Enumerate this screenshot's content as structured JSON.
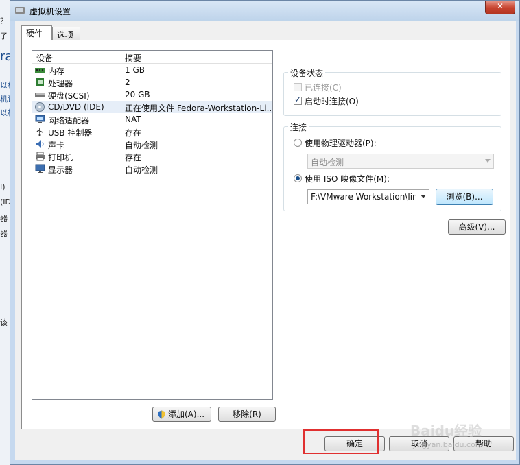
{
  "background_window": {
    "fragments": [
      "？",
      "了",
      "ra",
      "以材",
      "机设",
      "以材",
      "I)",
      "(ID",
      "器",
      "器",
      "该"
    ]
  },
  "dialog": {
    "title": "虚拟机设置",
    "tabs": [
      {
        "label": "硬件",
        "active": true
      },
      {
        "label": "选项",
        "active": false
      }
    ]
  },
  "device_list": {
    "columns": {
      "device": "设备",
      "summary": "摘要"
    },
    "rows": [
      {
        "name": "内存",
        "summary": "1 GB",
        "icon": "memory-icon"
      },
      {
        "name": "处理器",
        "summary": "2",
        "icon": "cpu-icon"
      },
      {
        "name": "硬盘(SCSI)",
        "summary": "20 GB",
        "icon": "harddisk-icon"
      },
      {
        "name": "CD/DVD (IDE)",
        "summary": "正在使用文件 Fedora-Workstation-Li...",
        "icon": "cdrom-icon",
        "selected": true
      },
      {
        "name": "网络适配器",
        "summary": "NAT",
        "icon": "network-icon"
      },
      {
        "name": "USB 控制器",
        "summary": "存在",
        "icon": "usb-icon"
      },
      {
        "name": "声卡",
        "summary": "自动检测",
        "icon": "sound-icon"
      },
      {
        "name": "打印机",
        "summary": "存在",
        "icon": "printer-icon"
      },
      {
        "name": "显示器",
        "summary": "自动检测",
        "icon": "monitor-icon"
      }
    ],
    "add_button": "添加(A)...",
    "remove_button": "移除(R)"
  },
  "device_status": {
    "title": "设备状态",
    "connected": {
      "label": "已连接(C)",
      "checked": false,
      "disabled": true
    },
    "connect_at_power_on": {
      "label": "启动时连接(O)",
      "checked": true
    }
  },
  "connection": {
    "title": "连接",
    "use_physical": {
      "label": "使用物理驱动器(P):",
      "selected": false
    },
    "physical_drive_value": "自动检测",
    "use_iso": {
      "label": "使用 ISO 映像文件(M):",
      "selected": true
    },
    "iso_path": "F:\\VMware Workstation\\linu",
    "browse_button": "浏览(B)..."
  },
  "advanced_button": "高级(V)...",
  "footer": {
    "ok_button": "确定",
    "cancel_button": "取消",
    "help_button": "帮助"
  },
  "annotation": {
    "highlight_color": "#e03030"
  },
  "watermark": {
    "text": "Baidu经验",
    "subtext": "jingyan.baidu.com"
  }
}
